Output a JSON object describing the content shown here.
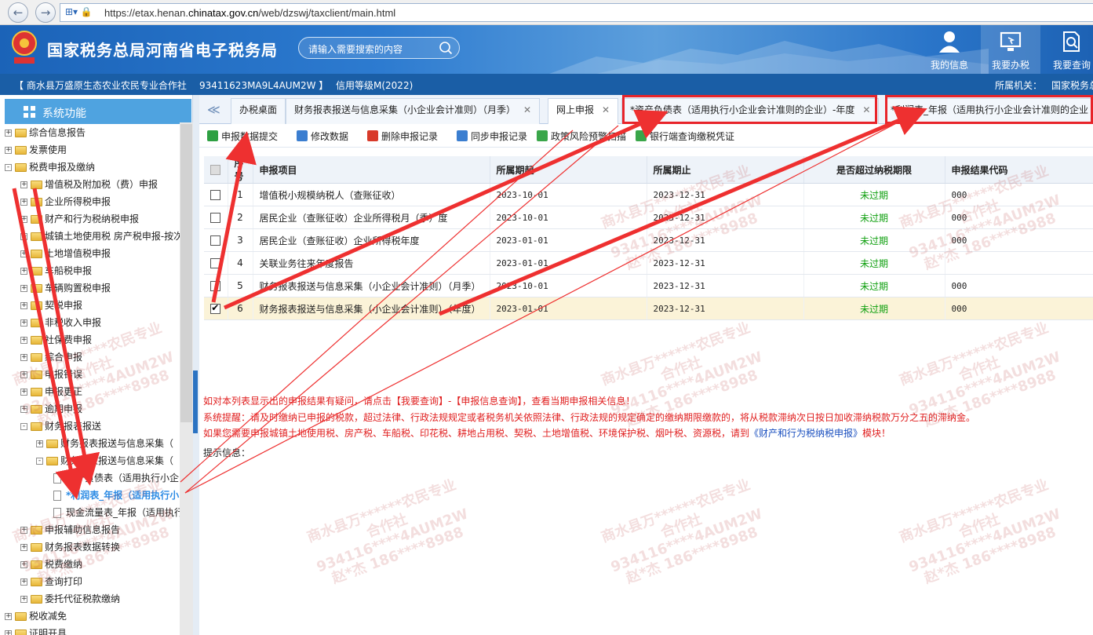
{
  "browser": {
    "back_icon": "back-arrow-icon",
    "forward_icon": "forward-arrow-icon",
    "url_prefix": "https://etax.henan.",
    "url_domain": "chinatax.gov.cn",
    "url_suffix": "/web/dzswj/taxclient/main.html"
  },
  "header": {
    "site_title": "国家税务总局河南省电子税务局",
    "search_placeholder": "请输入需要搜索的内容",
    "nav": [
      {
        "label": "我的信息",
        "icon": "user-icon"
      },
      {
        "label": "我要办税",
        "icon": "monitor-icon"
      },
      {
        "label": "我要查询",
        "icon": "document-search-icon"
      }
    ]
  },
  "org": {
    "name": "【 商水县万盛原生态农业农民专业合作社",
    "code": "93411623MA9L4AUM2W 】",
    "credit": "信用等级M(2022)",
    "authority_label": "所属机关：",
    "authority": "国家税务总"
  },
  "sidebar": {
    "title": "系统功能",
    "items": [
      {
        "label": "综合信息报告",
        "exp": "+"
      },
      {
        "label": "发票使用",
        "exp": "+"
      },
      {
        "label": "税费申报及缴纳",
        "exp": "-"
      },
      {
        "label": "增值税及附加税（费）申报",
        "exp": "+"
      },
      {
        "label": "企业所得税申报",
        "exp": "+"
      },
      {
        "label": "财产和行为税纳税申报",
        "exp": "+"
      },
      {
        "label": "城镇土地使用税 房产税申报-按次",
        "exp": "+"
      },
      {
        "label": "土地增值税申报",
        "exp": "+"
      },
      {
        "label": "车船税申报",
        "exp": "+"
      },
      {
        "label": "车辆购置税申报",
        "exp": "+"
      },
      {
        "label": "契税申报",
        "exp": "+"
      },
      {
        "label": "非税收入申报",
        "exp": "+"
      },
      {
        "label": "社保费申报",
        "exp": "+"
      },
      {
        "label": "综合申报",
        "exp": "+"
      },
      {
        "label": "申报错误",
        "exp": "+"
      },
      {
        "label": "申报更正",
        "exp": "+"
      },
      {
        "label": "逾期申报",
        "exp": "+"
      },
      {
        "label": "财务报表报送",
        "exp": "-"
      },
      {
        "label": "财务报表报送与信息采集（",
        "exp": "+"
      },
      {
        "label": "财务报表报送与信息采集（",
        "exp": "-"
      },
      {
        "label": "资产负债表（适用执行小企",
        "exp": ""
      },
      {
        "label": "*利润表_年报（适用执行小",
        "exp": ""
      },
      {
        "label": "现金流量表_年报（适用执行",
        "exp": ""
      },
      {
        "label": "申报辅助信息报告",
        "exp": "+"
      },
      {
        "label": "财务报表数据转换",
        "exp": "+"
      },
      {
        "label": "税费缴纳",
        "exp": "+"
      },
      {
        "label": "查询打印",
        "exp": "+"
      },
      {
        "label": "委托代征税款缴纳",
        "exp": "+"
      },
      {
        "label": "税收减免",
        "exp": "+"
      },
      {
        "label": "证明开具",
        "exp": "+"
      }
    ]
  },
  "tabs": {
    "scroll_left": "≪",
    "items": [
      {
        "label": "办税桌面",
        "close": ""
      },
      {
        "label": "财务报表报送与信息采集（小企业会计准则）（月季）",
        "close": "✕"
      },
      {
        "label": "网上申报",
        "close": "✕"
      },
      {
        "label": "*资产负债表（适用执行小企业会计准则的企业）-年度",
        "close": "✕"
      },
      {
        "label": "*利润表_年报（适用执行小企业会计准则的企业",
        "close": ""
      }
    ]
  },
  "toolbar": {
    "items": [
      {
        "label": "申报数据提交",
        "icon": "check-icon",
        "color": "#2ea043"
      },
      {
        "label": "修改数据",
        "icon": "edit-icon",
        "color": "#3b7ed0"
      },
      {
        "label": "删除申报记录",
        "icon": "delete-icon",
        "color": "#d83a2a"
      },
      {
        "label": "同步申报记录",
        "icon": "sync-icon",
        "color": "#3b7ed0"
      },
      {
        "label": "政策风险预警扫描",
        "icon": "scan-icon",
        "color": "#3aa64a"
      },
      {
        "label": "银行端查询缴税凭证",
        "icon": "bank-query-icon",
        "color": "#3aa64a"
      }
    ]
  },
  "table": {
    "columns": [
      "序号",
      "申报项目",
      "所属期起",
      "所属期止",
      "是否超过纳税期限",
      "申报结果代码"
    ],
    "rows": [
      {
        "no": "1",
        "item": "增值税小规模纳税人（查账征收）",
        "start": "2023-10-01",
        "end": "2023-12-31",
        "status": "未过期",
        "code": "000",
        "checked": false
      },
      {
        "no": "2",
        "item": "居民企业（查账征收）企业所得税月（季）度",
        "start": "2023-10-01",
        "end": "2023-12-31",
        "status": "未过期",
        "code": "000",
        "checked": false
      },
      {
        "no": "3",
        "item": "居民企业（查账征收）企业所得税年度",
        "start": "2023-01-01",
        "end": "2023-12-31",
        "status": "未过期",
        "code": "000",
        "checked": false
      },
      {
        "no": "4",
        "item": "关联业务往来年度报告",
        "start": "2023-01-01",
        "end": "2023-12-31",
        "status": "未过期",
        "code": "",
        "checked": false
      },
      {
        "no": "5",
        "item": "财务报表报送与信息采集（小企业会计准则）（月季）",
        "start": "2023-10-01",
        "end": "2023-12-31",
        "status": "未过期",
        "code": "000",
        "checked": false
      },
      {
        "no": "6",
        "item": "财务报表报送与信息采集（小企业会计准则）（年度）",
        "start": "2023-01-01",
        "end": "2023-12-31",
        "status": "未过期",
        "code": "000",
        "checked": true
      }
    ]
  },
  "notes": {
    "line1": "如对本列表显示出的申报结果有疑问，请点击【我要查询】-【申报信息查询】，查看当期申报相关信息！",
    "line2": "系统提醒：请及时缴纳已申报的税款，超过法律、行政法规规定或者税务机关依照法律、行政法规的规定确定的缴纳期限缴款的，将从税款滞纳次日按日加收滞纳税款万分之五的滞纳金。",
    "line3_prefix": "如果您需要申报城镇土地使用税、房产税、车船税、印花税、耕地占用税、契税、土地增值税、环境保护税、烟叶税、资源税，请到",
    "line3_link": "《财产和行为税纳税申报》",
    "line3_suffix": "模块！",
    "hint": "提示信息："
  },
  "watermark": {
    "line1": "商水县万******农民专业",
    "line2": "合作社",
    "line3": "934116****4AUM2W",
    "line4": "赵*杰 186****8988"
  },
  "colors": {
    "accent": "#e8242a",
    "banner": "#1d62b4",
    "ok": "#10a010",
    "note_red": "#e02020"
  }
}
